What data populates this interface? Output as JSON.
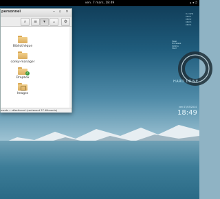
{
  "top_panel": {
    "clock": "ven. 7 mars, 18:49",
    "tray_icons": [
      "network-icon",
      "volume-icon",
      "power-icon"
    ]
  },
  "window": {
    "title": "personnel",
    "buttons": [
      "minimize-icon",
      "maximize-icon",
      "close-icon"
    ],
    "toolbar": {
      "search": "⌕",
      "list_view": "≡",
      "view_options": "▾",
      "menu": "⌄",
      "settings": "⚙"
    },
    "items": [
      {
        "label": "Bibliothèque",
        "icon": "folder-icon"
      },
      {
        "label": "conky-manager",
        "icon": "folder-icon"
      },
      {
        "label": "Dropbox",
        "icon": "folder-dropbox-synced-icon"
      },
      {
        "label": "Images",
        "icon": "folder-images-icon"
      }
    ],
    "status": "ments » sélectionné (contenant 27 éléments)"
  },
  "conky": {
    "stats": [
      "0.2 GHz",
      "CPU 1",
      "CPU 2",
      "CPU 3",
      "CPU 4"
    ],
    "swap": [
      "Swap",
      "Processes",
      "Uptime",
      "Used"
    ],
    "hard_drive": "HARD DRIVE",
    "date": "ven 07/03/2014",
    "time": "18:49"
  },
  "colors": {
    "panel": "#000000",
    "folder": "#e9c07a",
    "accent": "#3a9a3a",
    "sea": "#3d7d98"
  }
}
